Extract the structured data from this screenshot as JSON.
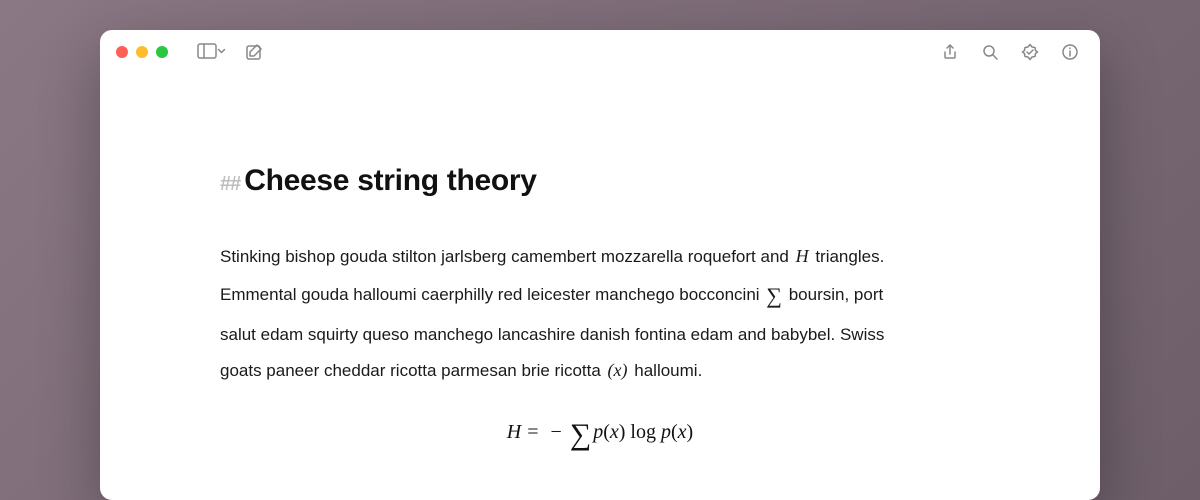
{
  "heading": {
    "marker": "##",
    "text": "Cheese string theory"
  },
  "paragraph": {
    "seg1": "Stinking bishop gouda stilton jarlsberg camembert mozzarella roquefort and ",
    "inline1": "H",
    "seg2": " triangles. Emmental gouda halloumi caerphilly red leicester manchego bocconcini ",
    "inline2": "∑",
    "seg3": " boursin, port salut edam squirty queso manchego lancashire danish fontina edam and babybel. Swiss goats paneer cheddar ricotta parmesan brie ricotta ",
    "inline3": "(x)",
    "seg4": " halloumi."
  },
  "equation": {
    "lhs_var": "H",
    "eq": "=",
    "neg": "−",
    "sigma": "∑",
    "p": "p",
    "open": "(",
    "x": "x",
    "close": ")",
    "log": "log",
    "space": " "
  }
}
